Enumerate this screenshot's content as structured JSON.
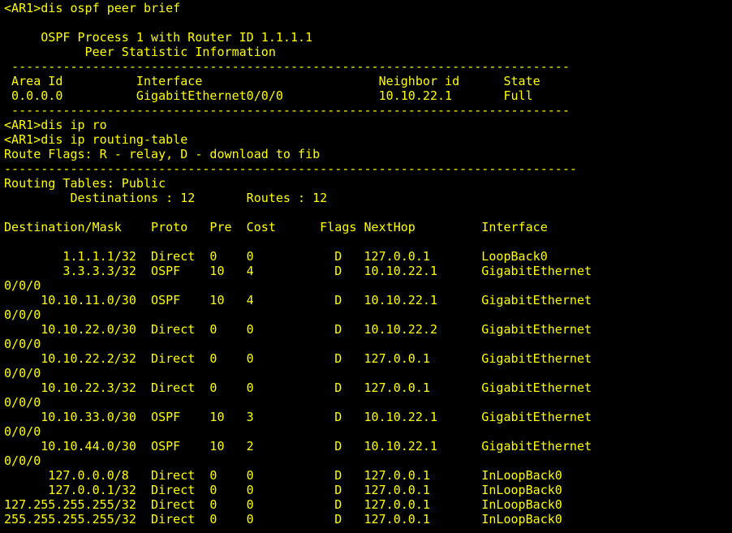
{
  "terminal": {
    "colors": {
      "background": "#000000",
      "foreground": "#ffff00"
    },
    "lines": [
      "<AR1>dis ospf peer brief",
      "",
      "     OSPF Process 1 with Router ID 1.1.1.1",
      "           Peer Statistic Information",
      " ----------------------------------------------------------------------------",
      " Area Id          Interface                        Neighbor id      State",
      " 0.0.0.0          GigabitEthernet0/0/0             10.10.22.1       Full",
      " ----------------------------------------------------------------------------",
      "<AR1>dis ip ro",
      "<AR1>dis ip routing-table",
      "Route Flags: R - relay, D - download to fib",
      "------------------------------------------------------------------------------",
      "Routing Tables: Public",
      "         Destinations : 12       Routes : 12",
      "",
      "Destination/Mask    Proto   Pre  Cost      Flags NextHop         Interface",
      "",
      "        1.1.1.1/32  Direct  0    0           D   127.0.0.1       LoopBack0",
      "        3.3.3.3/32  OSPF    10   4           D   10.10.22.1      GigabitEthernet",
      "0/0/0",
      "     10.10.11.0/30  OSPF    10   4           D   10.10.22.1      GigabitEthernet",
      "0/0/0",
      "     10.10.22.0/30  Direct  0    0           D   10.10.22.2      GigabitEthernet",
      "0/0/0",
      "     10.10.22.2/32  Direct  0    0           D   127.0.0.1       GigabitEthernet",
      "0/0/0",
      "     10.10.22.3/32  Direct  0    0           D   127.0.0.1       GigabitEthernet",
      "0/0/0",
      "     10.10.33.0/30  OSPF    10   3           D   10.10.22.1      GigabitEthernet",
      "0/0/0",
      "     10.10.44.0/30  OSPF    10   2           D   10.10.22.1      GigabitEthernet",
      "0/0/0",
      "      127.0.0.0/8   Direct  0    0           D   127.0.0.1       InLoopBack0",
      "      127.0.0.1/32  Direct  0    0           D   127.0.0.1       InLoopBack0",
      "127.255.255.255/32  Direct  0    0           D   127.0.0.1       InLoopBack0",
      "255.255.255.255/32  Direct  0    0           D   127.0.0.1       InLoopBack0"
    ]
  }
}
